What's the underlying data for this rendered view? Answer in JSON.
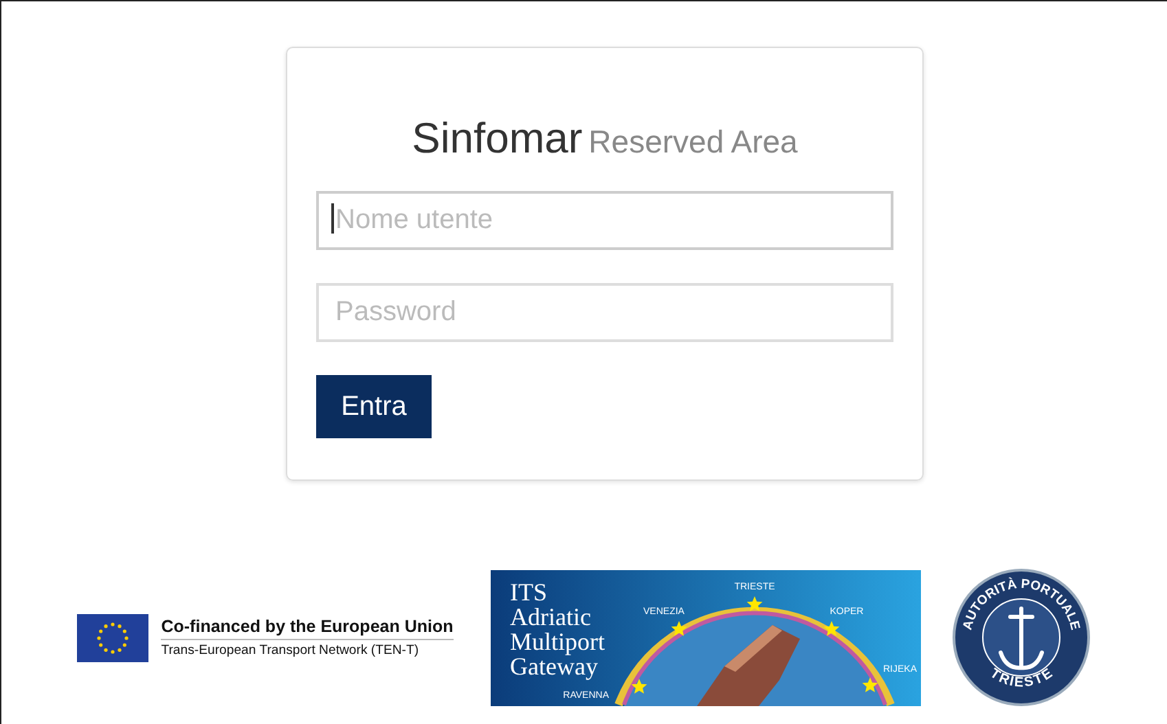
{
  "login": {
    "title": "Sinfomar",
    "subtitle": "Reserved Area",
    "fields": [
      {
        "placeholder": "Nome utente",
        "focused": true
      },
      {
        "placeholder": "Password",
        "focused": false
      }
    ],
    "button": "Entra"
  },
  "logos": {
    "eu": {
      "line1": "Co-financed by the European Union",
      "line2": "Trans-European Transport Network (TEN-T)"
    },
    "its": {
      "title_lines": [
        "ITS",
        "Adriatic",
        "Multiport",
        "Gateway"
      ],
      "ports": [
        "TRIESTE",
        "VENEZIA",
        "KOPER",
        "RIJEKA",
        "RAVENNA"
      ]
    },
    "seal": {
      "top": "AUTORITÀ PORTUALE",
      "bottom": "TRIESTE"
    }
  }
}
